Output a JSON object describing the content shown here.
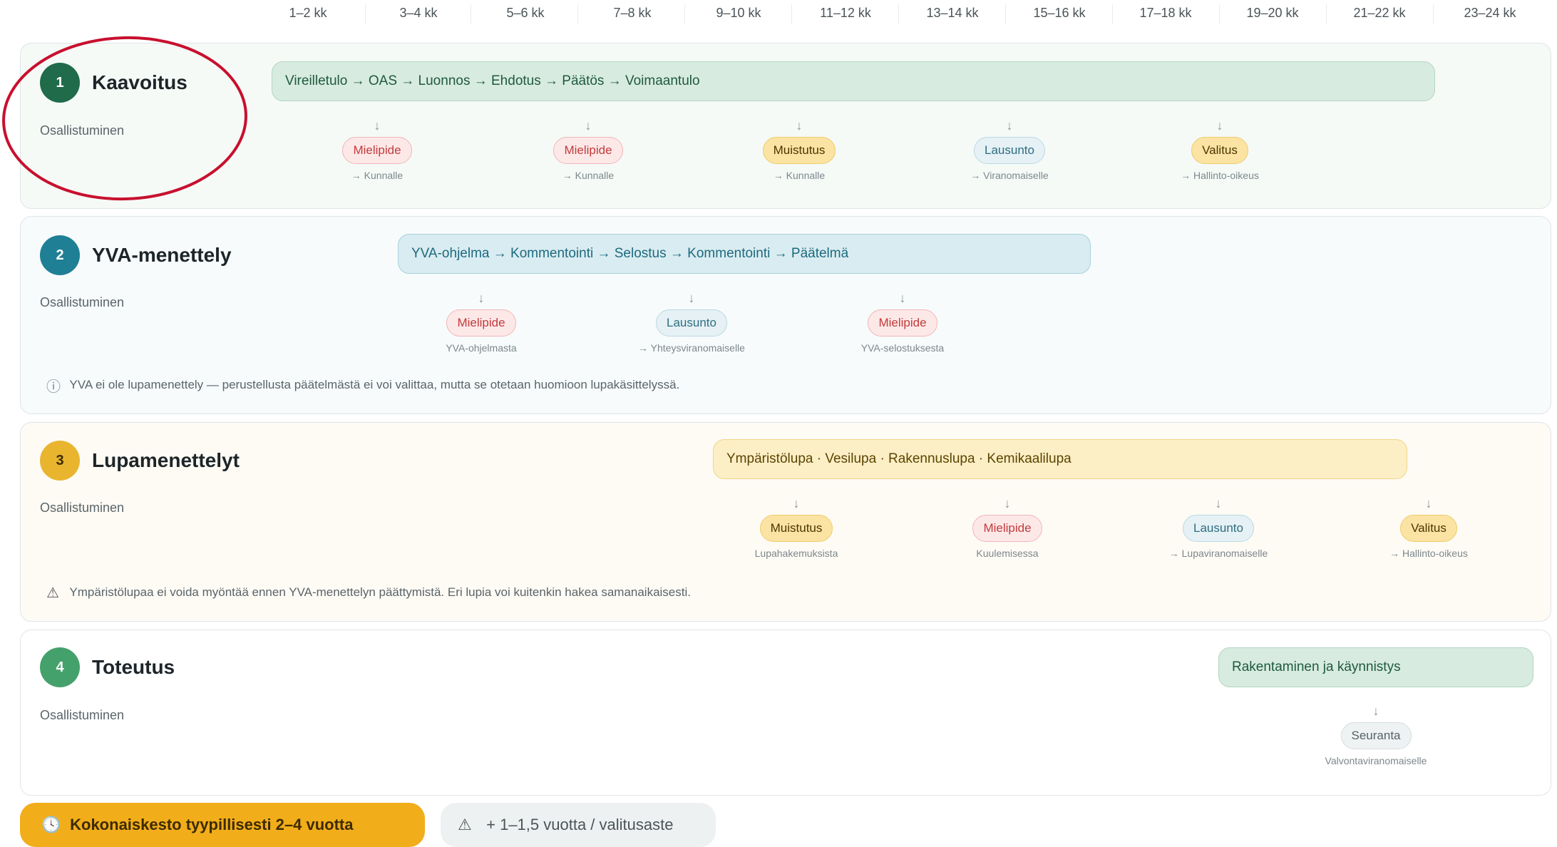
{
  "timeline": {
    "months": [
      "1–2 kk",
      "3–4 kk",
      "5–6 kk",
      "7–8 kk",
      "9–10 kk",
      "11–12 kk",
      "13–14 kk",
      "15–16 kk",
      "17–18 kk",
      "19–20 kk",
      "21–22 kk",
      "23–24 kk"
    ]
  },
  "phases": [
    {
      "number": "1",
      "title": "Kaavoitus",
      "subtitle": "Osallistuminen",
      "process": "Vireilletulo → OAS → Luonnos → Ehdotus → Päätös → Voimaantulo",
      "milestones": [
        {
          "label": "Mielipide",
          "note": "→ Kunnalle",
          "style": "red"
        },
        {
          "label": "Mielipide",
          "note": "→ Kunnalle",
          "style": "red"
        },
        {
          "label": "Muistutus",
          "note": "→ Kunnalle",
          "style": "yellow"
        },
        {
          "label": "Lausunto",
          "note": "→ Viranomaiselle",
          "style": "blue"
        },
        {
          "label": "Valitus",
          "note": "→ Hallinto-oikeus",
          "style": "yellow"
        }
      ]
    },
    {
      "number": "2",
      "title": "YVA-menettely",
      "subtitle": "Osallistuminen",
      "process": "YVA-ohjelma → Kommentointi → Selostus → Kommentointi → Päätelmä",
      "milestones": [
        {
          "label": "Mielipide",
          "note": "YVA-ohjelmasta",
          "style": "red"
        },
        {
          "label": "Lausunto",
          "note": "→ Yhteysviranomaiselle",
          "style": "blue"
        },
        {
          "label": "Mielipide",
          "note": "YVA-selostuksesta",
          "style": "red"
        }
      ],
      "info": "YVA ei ole lupamenettely — perustellusta päätelmästä ei voi valittaa, mutta se otetaan huomioon lupakäsittelyssä."
    },
    {
      "number": "3",
      "title": "Lupamenettelyt",
      "subtitle": "Osallistuminen",
      "process": "Ympäristölupa · Vesilupa · Rakennuslupa · Kemikaalilupa",
      "milestones": [
        {
          "label": "Muistutus",
          "note": "Lupahakemuksista",
          "style": "yellow"
        },
        {
          "label": "Mielipide",
          "note": "Kuulemisessa",
          "style": "red"
        },
        {
          "label": "Lausunto",
          "note": "→ Lupaviranomaiselle",
          "style": "blue"
        },
        {
          "label": "Valitus",
          "note": "→ Hallinto-oikeus",
          "style": "yellow"
        }
      ],
      "info": "Ympäristölupaa ei voida myöntää ennen YVA-menettelyn päättymistä. Eri lupia voi kuitenkin hakea samanaikaisesti."
    },
    {
      "number": "4",
      "title": "Toteutus",
      "subtitle": "Osallistuminen",
      "process": "Rakentaminen ja käynnistys",
      "milestones": [
        {
          "label": "Seuranta",
          "note": "Valvontaviranomaiselle",
          "style": "gray"
        }
      ]
    }
  ],
  "footer": {
    "duration": "Kokonaiskesto tyypillisesti 2–4 vuotta",
    "appeal": "+ 1–1,5 vuotta / valitusaste"
  },
  "icons": {
    "info": "info-icon",
    "warning": "warning-icon",
    "clock": "clock-icon",
    "arrow": "arrow-down-icon"
  },
  "colors": {
    "phase1": "#1f6b4a",
    "phase2": "#1f7f94",
    "phase3": "#e9b52f",
    "phase4": "#45a16c",
    "footer_accent": "#f2ad1b",
    "annotation": "#c8102e"
  }
}
